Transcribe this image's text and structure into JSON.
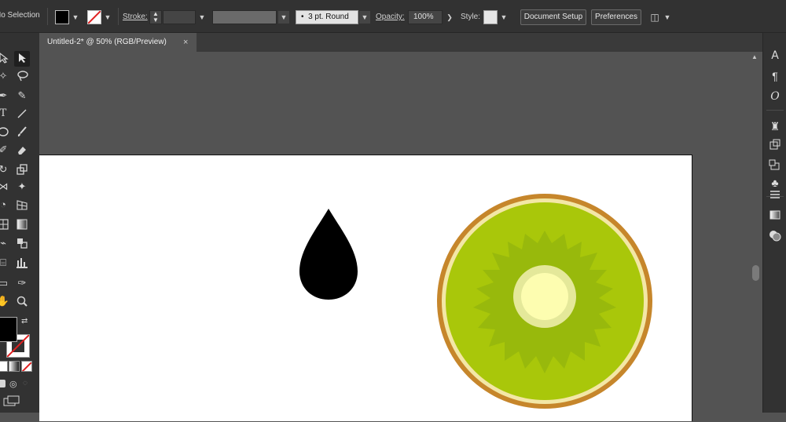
{
  "control_bar": {
    "selection_label": "No Selection",
    "stroke_label": "Stroke:",
    "brush_label": "3 pt. Round",
    "opacity_label": "Opacity:",
    "opacity_value": "100%",
    "style_label": "Style:",
    "doc_setup_label": "Document Setup",
    "preferences_label": "Preferences",
    "fill_color": "#000000",
    "stroke_color": "none"
  },
  "document": {
    "tab_title": "Untitled-2* @ 50% (RGB/Preview)",
    "close_glyph": "×"
  },
  "toolbar": {
    "tools": [
      "direct-selection-icon",
      "selection-icon",
      "magic-wand-icon",
      "lasso-icon",
      "pen-icon",
      "curvature-icon",
      "type-icon",
      "line-segment-icon",
      "ellipse-icon",
      "paintbrush-icon",
      "shaper-icon",
      "eraser-icon",
      "rotate-icon",
      "scale-icon",
      "width-icon",
      "puppet-warp-icon",
      "shape-builder-icon",
      "perspective-grid-icon",
      "mesh-icon",
      "gradient-icon",
      "eyedropper-icon",
      "blend-icon",
      "symbol-sprayer-icon",
      "column-graph-icon",
      "artboard-icon",
      "slice-icon",
      "hand-icon",
      "zoom-icon"
    ]
  },
  "right_panel": {
    "icons": [
      "character-icon",
      "paragraph-icon",
      "opentype-icon",
      "puppet-icon",
      "transform-icon",
      "align-icon",
      "symbols-icon",
      "stroke-panel-icon",
      "gradient-panel-icon",
      "transparency-icon"
    ],
    "char_glyph": "A",
    "para_glyph": "¶",
    "opentype_glyph": "O"
  },
  "artwork": {
    "drop_color": "#000000",
    "kiwi_rim": "#c6862b",
    "kiwi_skin": "#f3e7a6",
    "kiwi_flesh": "#a9c70a",
    "kiwi_inner": "#98b90c",
    "kiwi_core_ring": "#e4e89a",
    "kiwi_core": "#fdfdb0"
  }
}
